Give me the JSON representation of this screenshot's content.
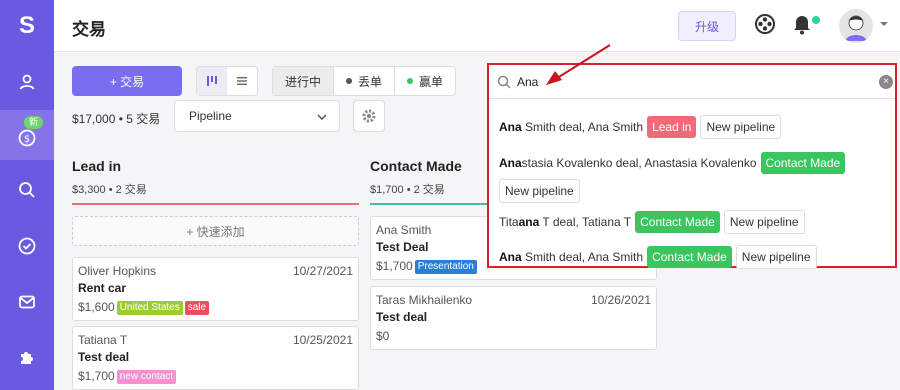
{
  "app": {
    "logo": "S",
    "page_title": "交易"
  },
  "sidebar": {
    "new_badge": "新",
    "items": [
      "contacts-icon",
      "deals-icon",
      "search-icon",
      "tasks-icon",
      "mail-icon",
      "plugins-icon"
    ]
  },
  "header": {
    "upgrade_label": "升级"
  },
  "toolbar": {
    "add_deal_label": "+ 交易",
    "status_in_progress": "进行中",
    "status_lost": "丢单",
    "status_won": "赢单",
    "summary": "$17,000 • 5 交易",
    "pipeline_value": "Pipeline"
  },
  "columns": [
    {
      "title": "Lead in",
      "summary": "$3,300 • 2 交易",
      "color": "#f06a7a",
      "quick_add": "+ 快速添加",
      "cards": [
        {
          "name": "Oliver Hopkins",
          "date": "10/27/2021",
          "deal": "Rent car",
          "amount": "$1,600",
          "tags": [
            {
              "label": "United States",
              "color": "#9acd32"
            },
            {
              "label": "sale",
              "color": "#e8505b"
            }
          ]
        },
        {
          "name": "Tatiana T",
          "date": "10/25/2021",
          "deal": "Test deal",
          "amount": "$1,700",
          "tags": [
            {
              "label": "new contact",
              "color": "#f78fd1"
            }
          ]
        }
      ]
    },
    {
      "title": "Contact Made",
      "summary": "$1,700 • 2 交易",
      "color": "#3dbfa0",
      "cards": [
        {
          "name": "Ana Smith",
          "deal": "Test Deal",
          "amount": "$1,700",
          "tags": [
            {
              "label": "Presentation",
              "color": "#2a7fd4"
            }
          ]
        },
        {
          "name": "Taras Mikhailenko",
          "date": "10/26/2021",
          "deal": "Test deal",
          "amount": "$0",
          "tags": []
        }
      ]
    }
  ],
  "search": {
    "query": "Ana",
    "results": [
      {
        "match": "Ana",
        "rest": " Smith deal, Ana Smith",
        "stage": "Lead in",
        "stage_color": "#f06a7a",
        "pipeline": "New pipeline"
      },
      {
        "match": "Ana",
        "rest": "stasia Kovalenko deal, Anastasia Kovalenko",
        "stage": "Contact Made",
        "stage_color": "#3ac55e",
        "pipeline": "New pipeline"
      },
      {
        "pre": "Ti",
        "match": "ta",
        "rest_pre": "ti",
        "match2": "ana",
        "rest": " T deal, Tatiana T",
        "stage": "Contact Made",
        "stage_color": "#3ac55e",
        "pipeline": "New pipeline"
      },
      {
        "match": "Ana",
        "rest": " Smith deal, Ana Smith",
        "stage": "Contact Made",
        "stage_color": "#3ac55e",
        "pipeline": "New pipeline"
      }
    ]
  },
  "colors": {
    "accent": "#6a5ae0",
    "highlight_border": "#d9202c",
    "arrow": "#c8151e"
  }
}
